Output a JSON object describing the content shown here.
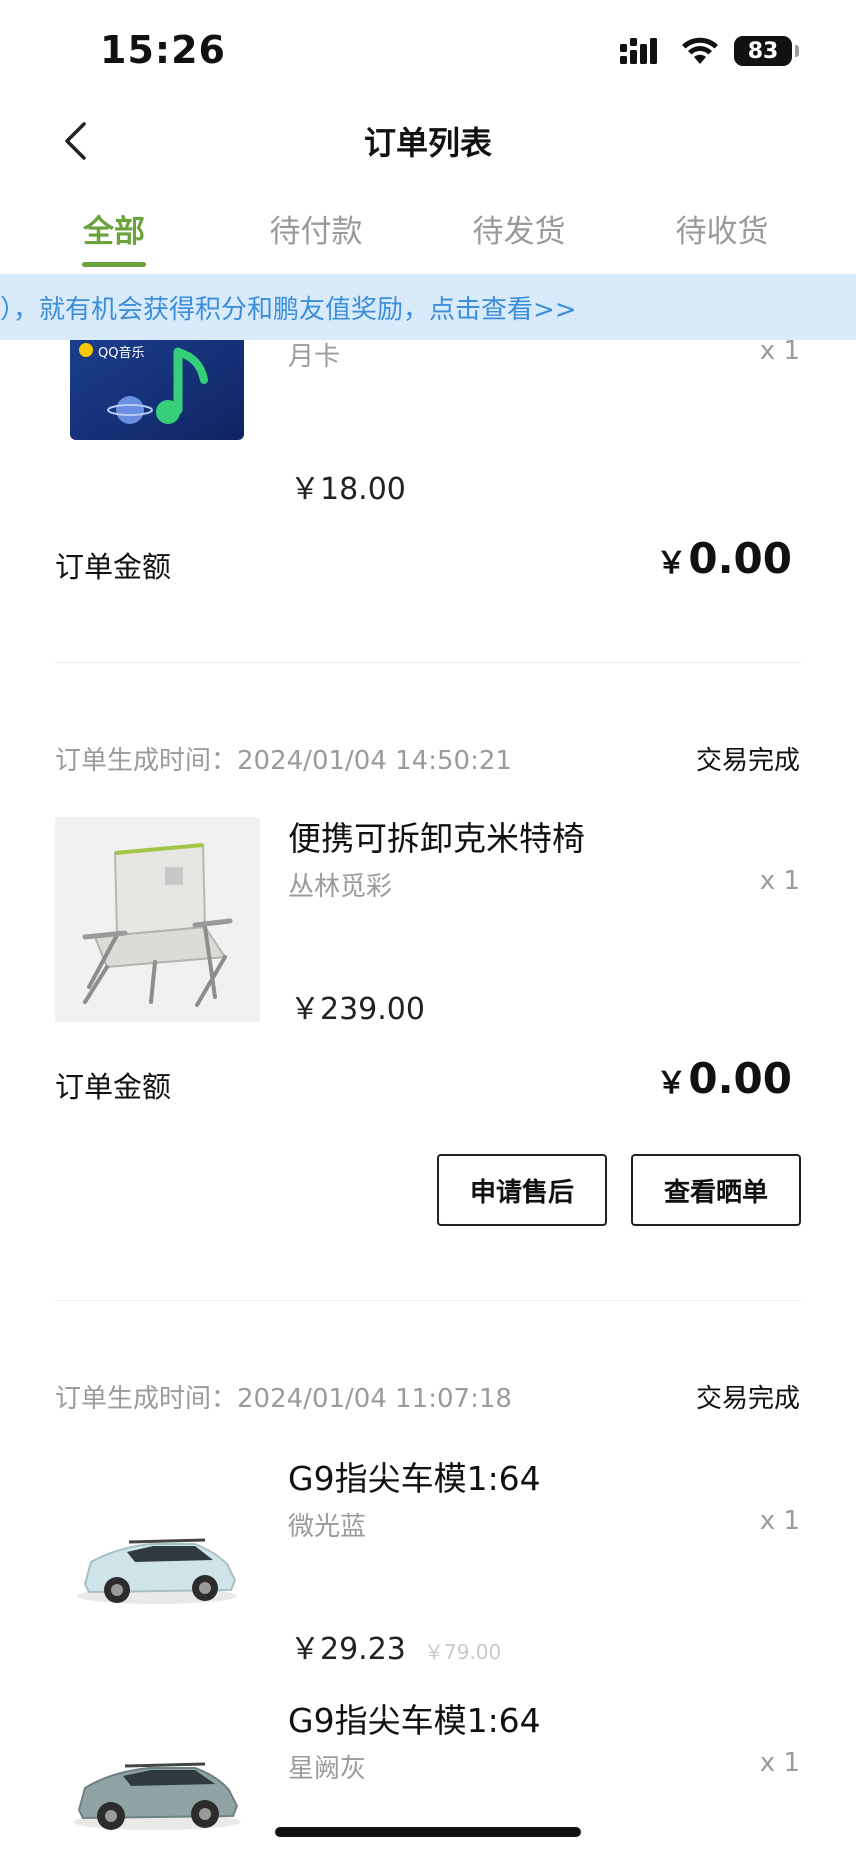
{
  "status_bar": {
    "time": "15:26",
    "battery": "83"
  },
  "nav": {
    "title": "订单列表"
  },
  "tabs": [
    {
      "label": "全部",
      "active": true
    },
    {
      "label": "待付款",
      "active": false
    },
    {
      "label": "待发货",
      "active": false
    },
    {
      "label": "待收货",
      "active": false
    }
  ],
  "banner": {
    "text": "），就有机会获得积分和鹏友值奖励，点击查看>>"
  },
  "orders": [
    {
      "status": "",
      "created_label": "",
      "created_time": "",
      "items": [
        {
          "name": "",
          "variant": "月卡",
          "qty": "x 1",
          "price": "￥18.00",
          "thumb_text": "QQ音乐"
        }
      ],
      "amount_label": "订单金额",
      "amount_currency": "￥",
      "amount_value": "0.00"
    },
    {
      "status": "交易完成",
      "created_label": "订单生成时间：",
      "created_time": "2024/01/04 14:50:21",
      "items": [
        {
          "name": "便携可拆卸克米特椅",
          "variant": "丛林觅彩",
          "qty": "x 1",
          "price": "￥239.00"
        }
      ],
      "amount_label": "订单金额",
      "amount_currency": "￥",
      "amount_value": "0.00",
      "buttons": [
        "申请售后",
        "查看晒单"
      ]
    },
    {
      "status": "交易完成",
      "created_label": "订单生成时间：",
      "created_time": "2024/01/04 11:07:18",
      "items": [
        {
          "name": "G9指尖车模1:64",
          "variant": "微光蓝",
          "qty": "x 1",
          "price": "￥29.23",
          "original_price": "￥79.00"
        },
        {
          "name": "G9指尖车模1:64",
          "variant": "星阙灰",
          "qty": "x 1"
        }
      ]
    }
  ],
  "colors": {
    "accent": "#6aa33c",
    "banner_bg": "#d9ebfb",
    "banner_text": "#3c8edb"
  }
}
